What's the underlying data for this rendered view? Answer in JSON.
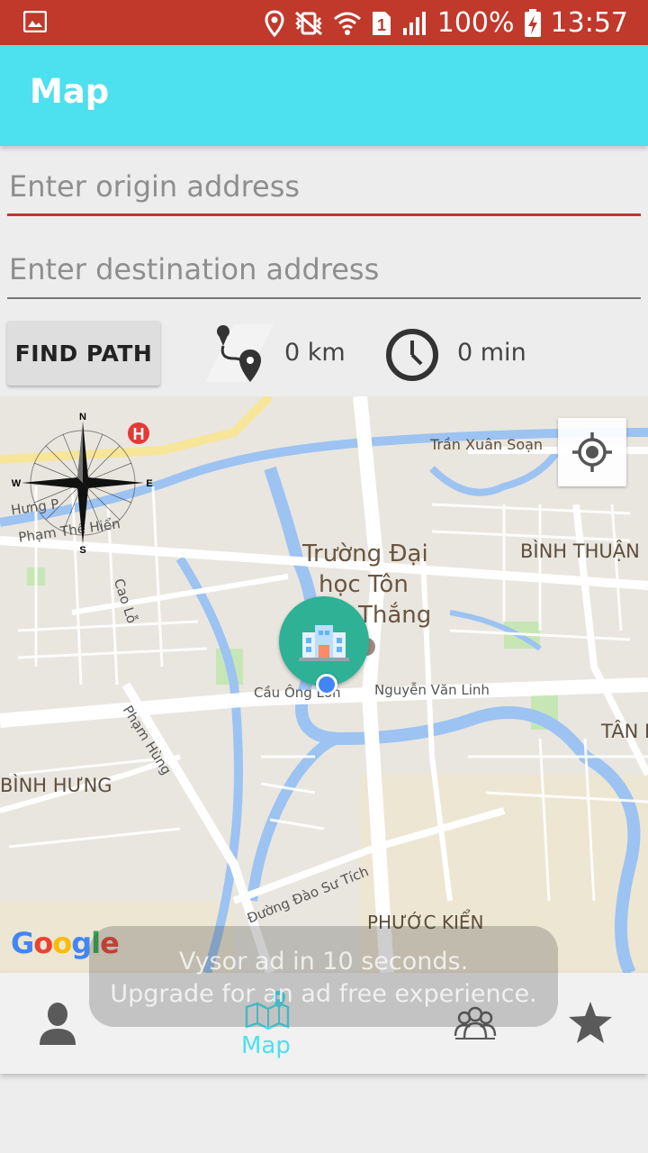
{
  "status_bar": {
    "battery": "100%",
    "time": "13:57",
    "sim_slot": "1"
  },
  "app_bar": {
    "title": "Map"
  },
  "form": {
    "origin_placeholder": "Enter origin address",
    "origin_value": "",
    "destination_placeholder": "Enter destination address",
    "destination_value": "",
    "find_button": "FIND PATH",
    "distance": "0 km",
    "duration": "0 min"
  },
  "map": {
    "labels": {
      "tran_xuan_soan": "Trần Xuân Soạn",
      "binh_thuan": "BÌNH THUẬN",
      "school_line1": "Trường Đại",
      "school_line2": "học Tôn",
      "school_line3": "Thắng",
      "cao_lo": "Cao Lỗ",
      "cau_ong_lon": "Cầu Ông Lớn",
      "nguyen_van_linh": "Nguyễn Văn Linh",
      "pham_hung": "Phạm Hùng",
      "binh_hung": "BÌNH HƯNG",
      "tan_phong": "TÂN P",
      "dao_su_tich": "Đường Đào Sư Tích",
      "phuoc_kien": "PHƯỚC KIỂN",
      "hung": "Hưng P",
      "pham_the_hien": "Phạm Thế Hiển"
    },
    "compass": {
      "n": "N",
      "s": "S",
      "e": "E",
      "w": "W"
    },
    "attribution": {
      "g1": "G",
      "o1": "o",
      "o2": "o",
      "g2": "g",
      "l": "l",
      "e": "e"
    },
    "colors": {
      "water": "#9cc3f2",
      "road": "#ffffff",
      "land": "#e9e6df",
      "highway": "#f7e59a",
      "park": "#c7e6b5"
    }
  },
  "bottom_nav": {
    "items": [
      {
        "icon": "person-icon",
        "label": ""
      },
      {
        "icon": "map-icon",
        "label": "Map"
      },
      {
        "icon": "group-icon",
        "label": ""
      },
      {
        "icon": "star-icon",
        "label": ""
      }
    ],
    "active_color": "#4de0ef"
  },
  "toast": {
    "line1": "Vysor ad in 10 seconds.",
    "line2": "Upgrade for an ad free experience."
  }
}
